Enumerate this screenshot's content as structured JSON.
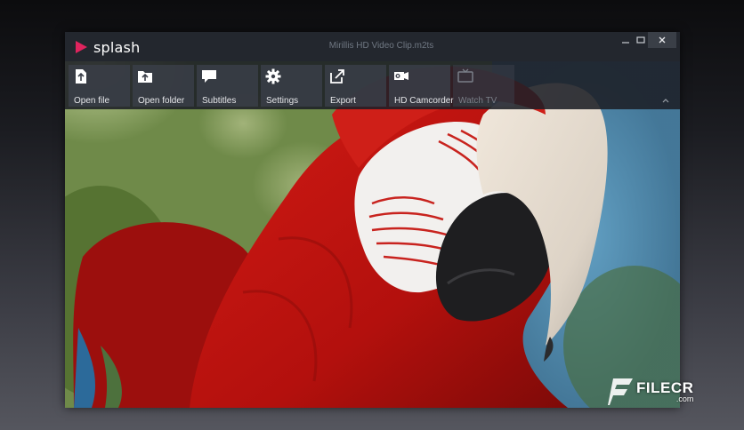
{
  "app": {
    "logo_text": "splash"
  },
  "window": {
    "file_title": "Mirillis HD Video Clip.m2ts"
  },
  "toolbar": {
    "buttons": [
      {
        "label": "Open file",
        "icon": "open-file-icon",
        "enabled": true
      },
      {
        "label": "Open folder",
        "icon": "open-folder-icon",
        "enabled": true
      },
      {
        "label": "Subtitles",
        "icon": "subtitles-icon",
        "enabled": true
      },
      {
        "label": "Settings",
        "icon": "gear-icon",
        "enabled": true
      },
      {
        "label": "Export",
        "icon": "export-icon",
        "enabled": true
      },
      {
        "label": "HD Camcorder",
        "icon": "camcorder-icon",
        "enabled": true
      },
      {
        "label": "Watch TV",
        "icon": "tv-icon",
        "enabled": false
      }
    ]
  },
  "video": {
    "content": "parrot-frame"
  },
  "watermark": {
    "brand": "FILECR",
    "domain": ".com"
  },
  "colors": {
    "accent": "#e0245e",
    "titlebar": "#23272e",
    "toolbar_button": "#3a3e48"
  }
}
